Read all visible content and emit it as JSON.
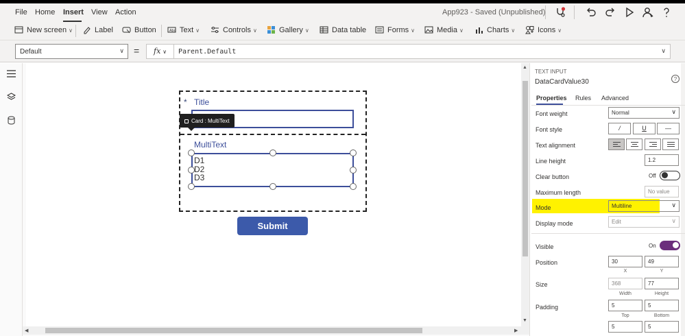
{
  "menu": {
    "items": [
      "File",
      "Home",
      "Insert",
      "View",
      "Action"
    ],
    "active": "Insert",
    "app_status": "App923 - Saved (Unpublished)"
  },
  "ribbon": {
    "new_screen": "New screen",
    "label": "Label",
    "button": "Button",
    "text": "Text",
    "controls": "Controls",
    "gallery": "Gallery",
    "data_table": "Data table",
    "forms": "Forms",
    "media": "Media",
    "charts": "Charts",
    "icons": "Icons"
  },
  "formula_bar": {
    "property": "Default",
    "equals": "=",
    "fx": "fx",
    "formula": "Parent.Default"
  },
  "canvas": {
    "required_star": "*",
    "title_label": "Title",
    "card_tooltip": "Card : MultiText",
    "multitext_label": "MultiText",
    "multitext_value": "D1\nD2\nD3",
    "submit_label": "Submit"
  },
  "properties": {
    "control_type": "TEXT INPUT",
    "control_name": "DataCardValue30",
    "help": "?",
    "tabs": [
      "Properties",
      "Rules",
      "Advanced"
    ],
    "active_tab": "Properties",
    "font_weight_label": "Font weight",
    "font_weight_value": "Normal",
    "font_style_label": "Font style",
    "font_style_buttons": [
      "/",
      "U",
      "—"
    ],
    "text_alignment_label": "Text alignment",
    "text_alignment_selected": "left",
    "line_height_label": "Line height",
    "line_height_value": "1.2",
    "clear_button_label": "Clear button",
    "clear_button_state": "Off",
    "max_length_label": "Maximum length",
    "max_length_placeholder": "No value",
    "mode_label": "Mode",
    "mode_value": "Multiline",
    "display_mode_label": "Display mode",
    "display_mode_value": "Edit",
    "visible_label": "Visible",
    "visible_state": "On",
    "position_label": "Position",
    "position_x": "30",
    "position_y": "49",
    "x_caption": "X",
    "y_caption": "Y",
    "size_label": "Size",
    "size_width": "368",
    "size_height": "77",
    "width_caption": "Width",
    "height_caption": "Height",
    "padding_label": "Padding",
    "padding_top": "5",
    "padding_bottom": "5",
    "top_caption": "Top",
    "bottom_caption": "Bottom",
    "padding_left": "5",
    "padding_right": "5"
  },
  "colors": {
    "accent": "#3c4e9a",
    "submit": "#3c5aaa",
    "toggle_on": "#6b2e7c",
    "mode_highlight": "#fff200"
  }
}
